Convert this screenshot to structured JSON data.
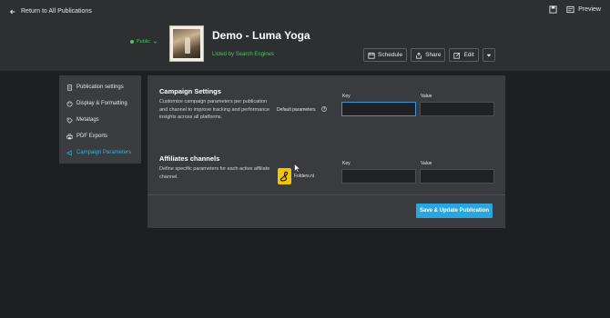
{
  "header": {
    "back_label": "Return to All Publications",
    "preview_label": "Preview",
    "status_label": "Public",
    "publication_title": "Demo - Luma Yoga",
    "publication_subtitle": "Listed by Search Engines",
    "actions": {
      "schedule": "Schedule",
      "share": "Share",
      "edit": "Edit"
    }
  },
  "sidebar": {
    "items": [
      {
        "label": "Publication settings",
        "icon": "document-icon"
      },
      {
        "label": "Display & Formatting",
        "icon": "palette-icon"
      },
      {
        "label": "Metatags",
        "icon": "tag-icon"
      },
      {
        "label": "PDF Exports",
        "icon": "printer-icon"
      },
      {
        "label": "Campaign Parameters",
        "icon": "megaphone-icon",
        "active": true
      }
    ]
  },
  "campaign": {
    "title": "Campaign Settings",
    "description": "Customize campaign parameters per publication and channel to improve tracking and performance insights across all platforms.",
    "default_params_label": "Default parameters",
    "key_label": "Key",
    "value_label": "Value",
    "key_value": "",
    "value_value": ""
  },
  "affiliates": {
    "title": "Affiliates channels",
    "description": "Define specific parameters for each active affiliate channel.",
    "channel_name": "Folders.nl",
    "key_label": "Key",
    "value_label": "Value",
    "key_value": "",
    "value_value": ""
  },
  "save_label": "Save & Update Publication",
  "colors": {
    "accent": "#29a6e0",
    "status_green": "#4cc36a",
    "folders_yellow": "#f2c500"
  }
}
